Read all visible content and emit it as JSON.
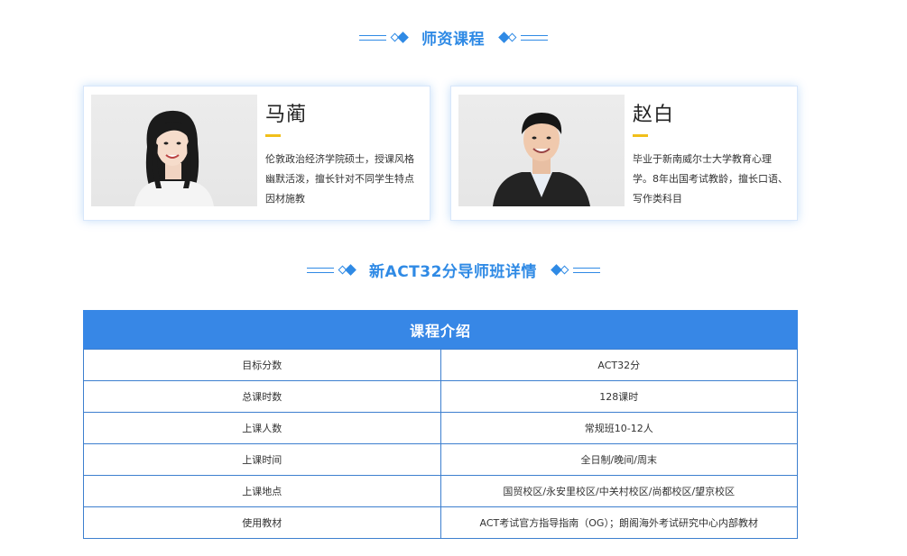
{
  "sections": {
    "teachers_title": "师资课程",
    "details_title": "新ACT32分导师班详情"
  },
  "teachers": [
    {
      "name": "马蔺",
      "desc_lines": [
        "伦敦政治经济学院硕士，授课风格",
        "幽默活泼，擅长针对不同学生特点",
        "因材施教"
      ]
    },
    {
      "name": "赵白",
      "desc_lines": [
        "毕业于新南威尔士大学教育心理",
        "学。8年出国考试教龄，擅长口语、",
        "写作类科目"
      ]
    }
  ],
  "table": {
    "header": "课程介绍",
    "rows": [
      [
        "目标分数",
        "ACT32分"
      ],
      [
        "总课时数",
        "128课时"
      ],
      [
        "上课人数",
        "常规班10-12人"
      ],
      [
        "上课时间",
        "全日制/晚间/周末"
      ],
      [
        "上课地点",
        "国贸校区/永安里校区/中关村校区/尚都校区/望京校区"
      ],
      [
        "使用教材",
        "ACT考试官方指导指南（OG）；朗阁海外考试研究中心内部教材"
      ]
    ]
  },
  "colors": {
    "accent": "#2f8ae5",
    "table_header_bg": "#3787e6",
    "name_underline": "#f1bf1a"
  }
}
